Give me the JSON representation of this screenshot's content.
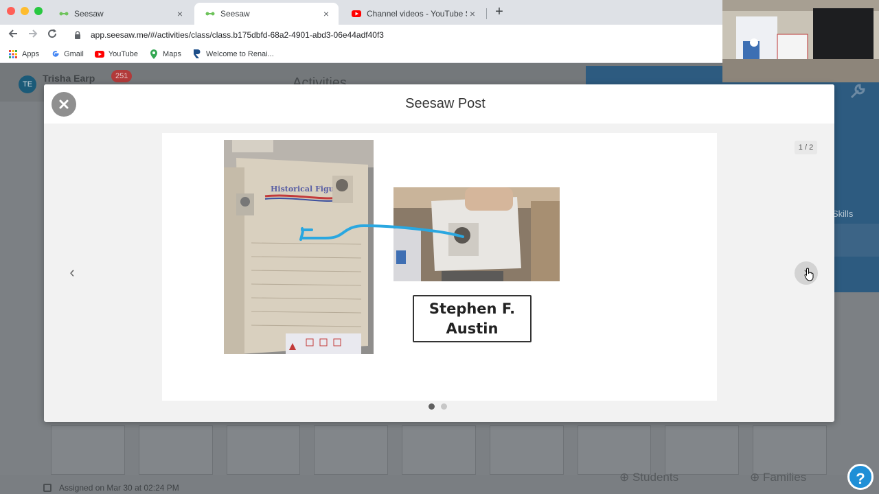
{
  "browser": {
    "tabs": [
      {
        "title": "Seesaw",
        "close": "×",
        "active": false,
        "icon": "seesaw-icon"
      },
      {
        "title": "Seesaw",
        "close": "×",
        "active": true,
        "icon": "seesaw-icon"
      },
      {
        "title": "Channel videos - YouTube Studio",
        "close": "×",
        "active": false,
        "icon": "youtube-icon"
      }
    ],
    "new_tab": "+",
    "url": "app.seesaw.me/#/activities/class/class.b175dbfd-68a2-4901-abd3-06e44adf40f3",
    "bookmarks": [
      {
        "label": "Apps",
        "icon": "apps-grid-icon"
      },
      {
        "label": "Gmail",
        "icon": "google-icon"
      },
      {
        "label": "YouTube",
        "icon": "youtube-icon"
      },
      {
        "label": "Maps",
        "icon": "maps-icon"
      },
      {
        "label": "Welcome to Renai...",
        "icon": "renaissance-icon"
      }
    ]
  },
  "background_app": {
    "user_initials": "TE",
    "user_name": "Trisha Earp",
    "notification_count": "251",
    "page_title": "Activities",
    "skills_label": "Skills",
    "assigned_text": "Assigned on Mar 30 at 02:24 PM",
    "students_label": "Students",
    "families_label": "Families",
    "help_label": "?"
  },
  "modal": {
    "title": "Seesaw Post",
    "close_label": "×",
    "page_indicator": "1 / 2",
    "prev_label": "‹",
    "next_label": "›",
    "pages_total": 2,
    "current_page": 1,
    "label_text": "Stephen F. Austin",
    "photo1_heading": "Historical Figures"
  },
  "colors": {
    "drawing_line": "#2aa7e0",
    "seesaw_green": "#6dc35a",
    "youtube_red": "#ff0000",
    "overlay_bg": "#7c8084"
  }
}
